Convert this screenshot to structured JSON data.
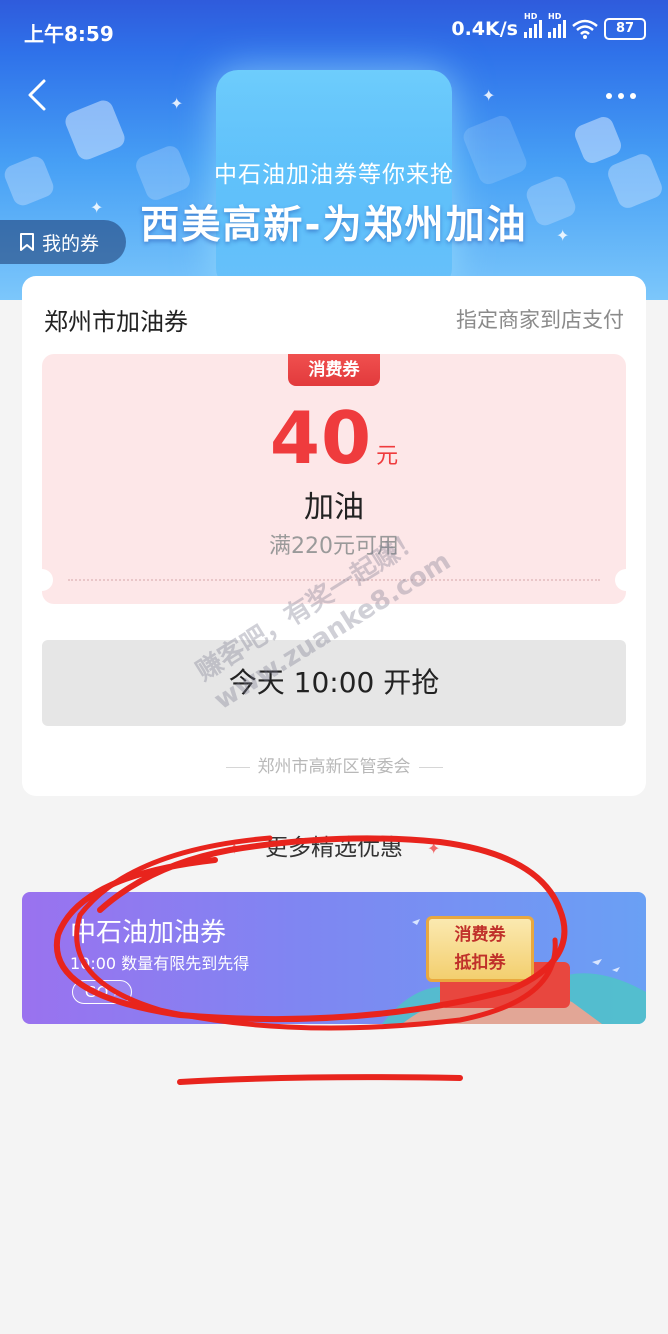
{
  "status_bar": {
    "time": "上午8:59",
    "speed": "0.4K/s",
    "hd_label": "HD",
    "battery": "87"
  },
  "header": {
    "subtitle": "中石油加油券等你来抢",
    "title": "西美高新-为郑州加油",
    "my_coupons": "我的券"
  },
  "coupon_card": {
    "title": "郑州市加油券",
    "note": "指定商家到店支付",
    "badge": "消费券",
    "amount": "40",
    "unit": "元",
    "kind": "加油",
    "condition": "满220元可用",
    "grab_button": "今天 10:00 开抢",
    "issuer": "郑州市高新区管委会"
  },
  "more": {
    "heading": "更多精选优惠",
    "promo": {
      "title": "中石油加油券",
      "subtitle": "10:00 数量有限先到先得",
      "go": "GO",
      "coupon_line1": "消费券",
      "coupon_line2": "抵扣券"
    }
  },
  "watermark": {
    "line1": "赚客吧，有奖一起赚！",
    "line2": "www.zuanke8.com"
  },
  "colors": {
    "accent_red": "#ef3b3d",
    "hero_blue": "#2f72ea",
    "annotation_red": "#e8241d"
  }
}
